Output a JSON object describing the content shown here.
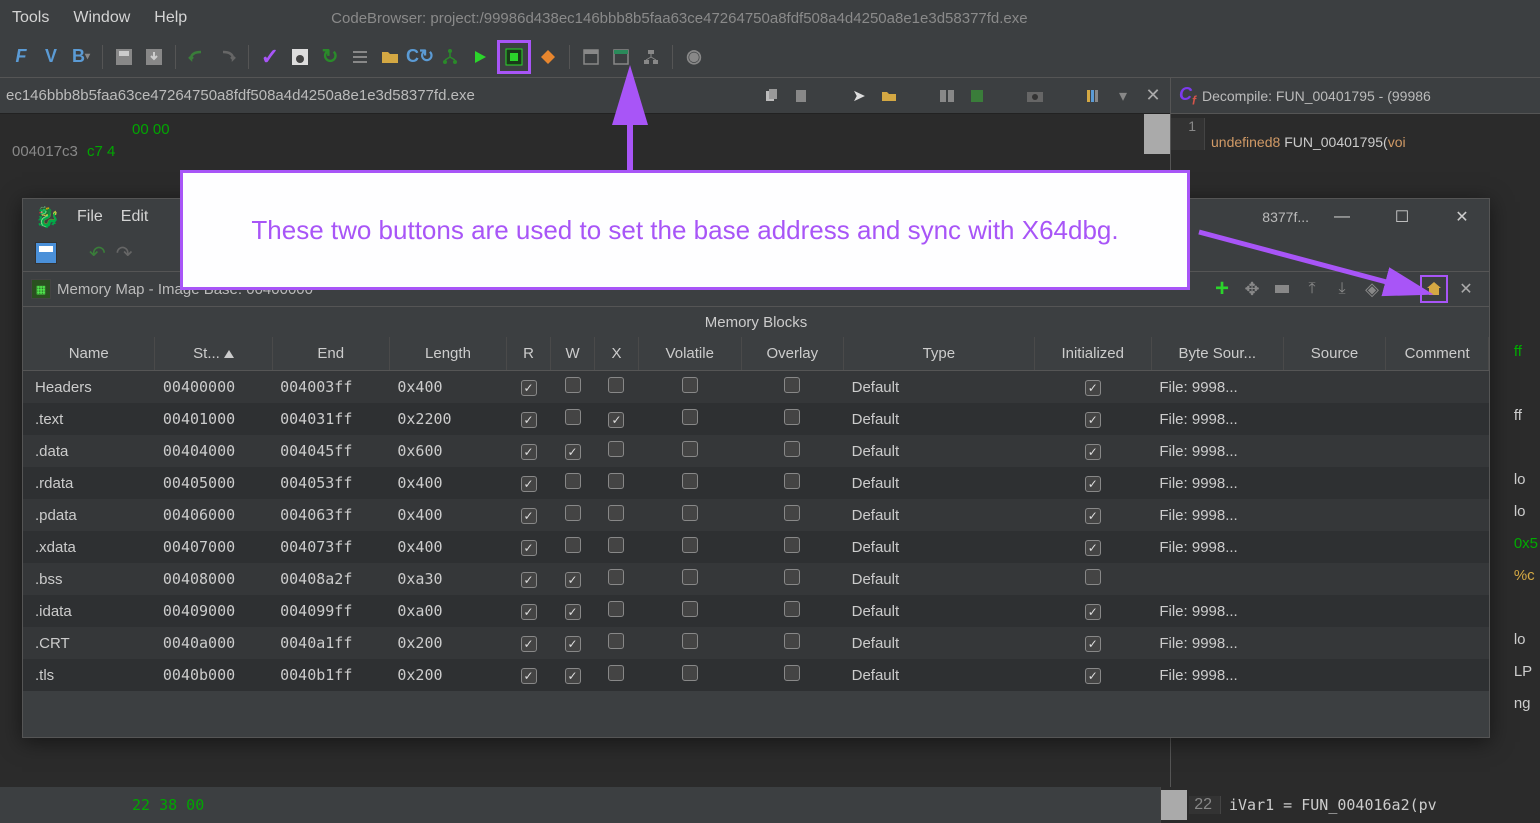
{
  "menubar": {
    "tools": "Tools",
    "window": "Window",
    "help": "Help"
  },
  "title": "CodeBrowser: project:/99986d438ec146bbb8b5faa63ce47264750a8fdf508a4d4250a8e1e3d58377fd.exe",
  "subheader": {
    "filename": "ec146bbb8b5faa63ce47264750a8fdf508a4d4250a8e1e3d58377fd.exe"
  },
  "hexlines": {
    "l1_bytes": "00  00",
    "l2_addr": "004017c3",
    "l2_bytes": "c7  4"
  },
  "callout": "These two buttons are used to set the base address and sync with X64dbg.",
  "memwin": {
    "menu": {
      "file": "File",
      "edit": "Edit"
    },
    "titlebar_partial": "8377f...",
    "title": "Memory Map - Image Base: 00400000",
    "caption": "Memory Blocks",
    "columns": [
      "Name",
      "St...",
      "End",
      "Length",
      "R",
      "W",
      "X",
      "Volatile",
      "Overlay",
      "Type",
      "Initialized",
      "Byte Sour...",
      "Source",
      "Comment"
    ],
    "rows": [
      {
        "name": "Headers",
        "start": "00400000",
        "end": "004003ff",
        "len": "0x400",
        "r": true,
        "w": false,
        "x": false,
        "vol": false,
        "ov": false,
        "type": "Default",
        "init": true,
        "bs": "File: 9998...",
        "src": "",
        "cm": ""
      },
      {
        "name": ".text",
        "start": "00401000",
        "end": "004031ff",
        "len": "0x2200",
        "r": true,
        "w": false,
        "x": true,
        "vol": false,
        "ov": false,
        "type": "Default",
        "init": true,
        "bs": "File: 9998...",
        "src": "",
        "cm": ""
      },
      {
        "name": ".data",
        "start": "00404000",
        "end": "004045ff",
        "len": "0x600",
        "r": true,
        "w": true,
        "x": false,
        "vol": false,
        "ov": false,
        "type": "Default",
        "init": true,
        "bs": "File: 9998...",
        "src": "",
        "cm": ""
      },
      {
        "name": ".rdata",
        "start": "00405000",
        "end": "004053ff",
        "len": "0x400",
        "r": true,
        "w": false,
        "x": false,
        "vol": false,
        "ov": false,
        "type": "Default",
        "init": true,
        "bs": "File: 9998...",
        "src": "",
        "cm": ""
      },
      {
        "name": ".pdata",
        "start": "00406000",
        "end": "004063ff",
        "len": "0x400",
        "r": true,
        "w": false,
        "x": false,
        "vol": false,
        "ov": false,
        "type": "Default",
        "init": true,
        "bs": "File: 9998...",
        "src": "",
        "cm": ""
      },
      {
        "name": ".xdata",
        "start": "00407000",
        "end": "004073ff",
        "len": "0x400",
        "r": true,
        "w": false,
        "x": false,
        "vol": false,
        "ov": false,
        "type": "Default",
        "init": true,
        "bs": "File: 9998...",
        "src": "",
        "cm": ""
      },
      {
        "name": ".bss",
        "start": "00408000",
        "end": "00408a2f",
        "len": "0xa30",
        "r": true,
        "w": true,
        "x": false,
        "vol": false,
        "ov": false,
        "type": "Default",
        "init": false,
        "bs": "",
        "src": "",
        "cm": ""
      },
      {
        "name": ".idata",
        "start": "00409000",
        "end": "004099ff",
        "len": "0xa00",
        "r": true,
        "w": true,
        "x": false,
        "vol": false,
        "ov": false,
        "type": "Default",
        "init": true,
        "bs": "File: 9998...",
        "src": "",
        "cm": ""
      },
      {
        "name": ".CRT",
        "start": "0040a000",
        "end": "0040a1ff",
        "len": "0x200",
        "r": true,
        "w": true,
        "x": false,
        "vol": false,
        "ov": false,
        "type": "Default",
        "init": true,
        "bs": "File: 9998...",
        "src": "",
        "cm": ""
      },
      {
        "name": ".tls",
        "start": "0040b000",
        "end": "0040b1ff",
        "len": "0x200",
        "r": true,
        "w": true,
        "x": false,
        "vol": false,
        "ov": false,
        "type": "Default",
        "init": true,
        "bs": "File: 9998...",
        "src": "",
        "cm": ""
      }
    ]
  },
  "decompile": {
    "header": "Decompile: FUN_00401795 -  (99986",
    "line1": "undefined8 FUN_00401795(voi",
    "bottomline_num": "22",
    "bottomline": "iVar1 = FUN_004016a2(pv"
  },
  "rightfrags": [
    "ff",
    "ff",
    "lo",
    "lo",
    "0x5",
    "%c",
    "lo",
    "LP",
    "ng"
  ],
  "bottom": {
    "hex": "22  38  00"
  }
}
